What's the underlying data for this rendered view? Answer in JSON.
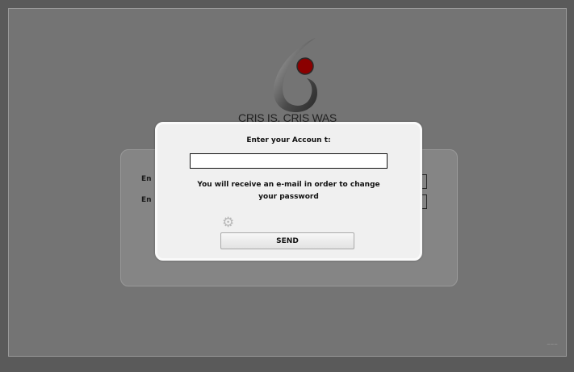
{
  "brand": {
    "name": "CRIS IS, CRIS WAS",
    "logo_accent": "#8b0000",
    "logo_icon": "swirl-logo-icon"
  },
  "login_panel": {
    "fields": [
      {
        "label": "Ente"
      },
      {
        "label": "Ente"
      }
    ]
  },
  "modal": {
    "title": "Enter your Accoun   t:",
    "account_value": "",
    "message": "You will receive   an  e-mail in order to change your password",
    "send_label": "SEND",
    "loading_icon": "gear-icon"
  },
  "footer": {
    "version": "———"
  }
}
